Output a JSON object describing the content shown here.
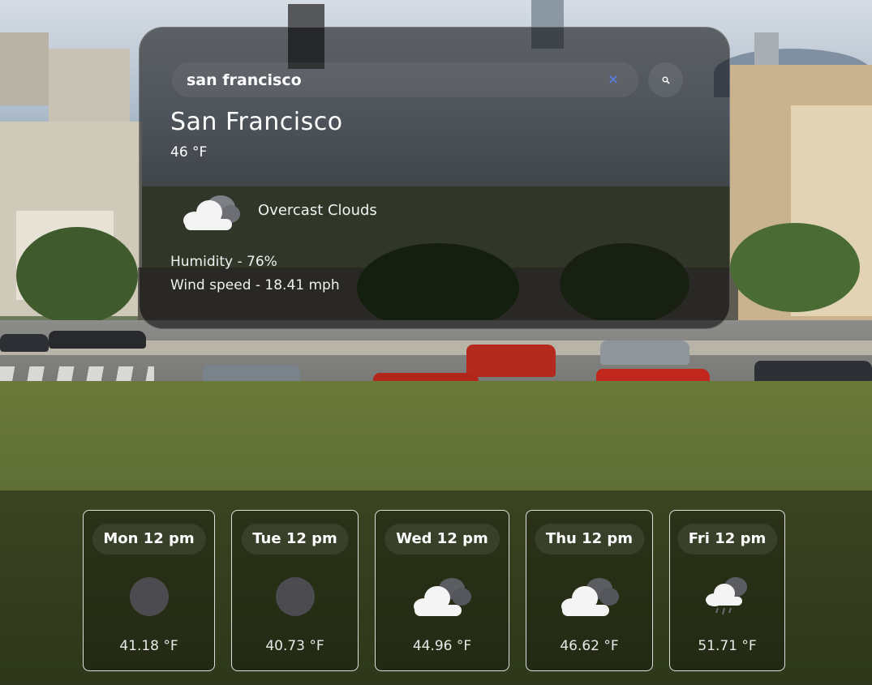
{
  "search": {
    "value": "san francisco",
    "clear_icon": "close-icon",
    "submit_icon": "search-icon"
  },
  "current": {
    "city": "San Francisco",
    "temperature": "46 °F",
    "condition": "Overcast Clouds",
    "condition_icon": "overcast-clouds-icon",
    "humidity": "Humidity - 76%",
    "wind": "Wind speed - 18.41 mph"
  },
  "forecast": [
    {
      "day": "Mon 12 pm",
      "temp": "41.18 °F",
      "icon": "clear-night-icon"
    },
    {
      "day": "Tue 12 pm",
      "temp": "40.73 °F",
      "icon": "clear-night-icon"
    },
    {
      "day": "Wed 12 pm",
      "temp": "44.96 °F",
      "icon": "broken-clouds-icon"
    },
    {
      "day": "Thu 12 pm",
      "temp": "46.62 °F",
      "icon": "broken-clouds-icon"
    },
    {
      "day": "Fri 12 pm",
      "temp": "51.71 °F",
      "icon": "rain-icon"
    }
  ],
  "colors": {
    "card_bg": "#000000",
    "clear_icon": "#5b7ee5",
    "text": "#ffffff"
  }
}
